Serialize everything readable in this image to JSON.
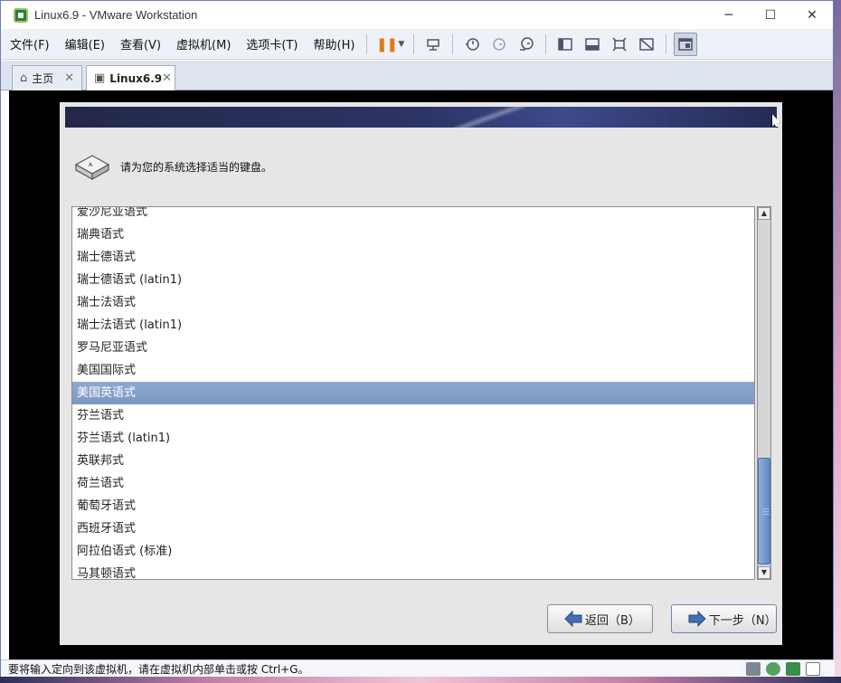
{
  "window": {
    "title": "Linux6.9 - VMware Workstation",
    "controls": {
      "minimize": "─",
      "maximize": "☐",
      "close": "✕"
    }
  },
  "menu": {
    "items": [
      "文件(F)",
      "编辑(E)",
      "查看(V)",
      "虚拟机(M)",
      "选项卡(T)",
      "帮助(H)"
    ]
  },
  "toolbar": {
    "icons": [
      "pause-icon",
      "send-ctrl-alt-del-icon",
      "snapshot-icon",
      "revert-snapshot-icon",
      "snapshot-manager-icon",
      "console-view-icon",
      "unity-icon",
      "fullscreen-icon",
      "stretch-icon",
      "library-icon"
    ]
  },
  "tabs": [
    {
      "label": "主页",
      "icon": "home-icon"
    },
    {
      "label": "Linux6.9",
      "icon": "vm-icon"
    }
  ],
  "installer": {
    "prompt": "请为您的系统选择适当的键盘。",
    "keyboard_layouts": [
      "爱沙尼亚语式",
      "瑞典语式",
      "瑞士德语式",
      "瑞士德语式 (latin1)",
      "瑞士法语式",
      "瑞士法语式 (latin1)",
      "罗马尼亚语式",
      "美国国际式",
      "美国英语式",
      "芬兰语式",
      "芬兰语式 (latin1)",
      "英联邦式",
      "荷兰语式",
      "葡萄牙语式",
      "西班牙语式",
      "阿拉伯语式 (标准)",
      "马其顿语式"
    ],
    "selected": "美国英语式",
    "scroll_position": 0.72,
    "back_label": "返回（B）",
    "next_label": "下一步（N）"
  },
  "status": {
    "text": "要将输入定向到该虚拟机，请在虚拟机内部单击或按 Ctrl+G。"
  }
}
